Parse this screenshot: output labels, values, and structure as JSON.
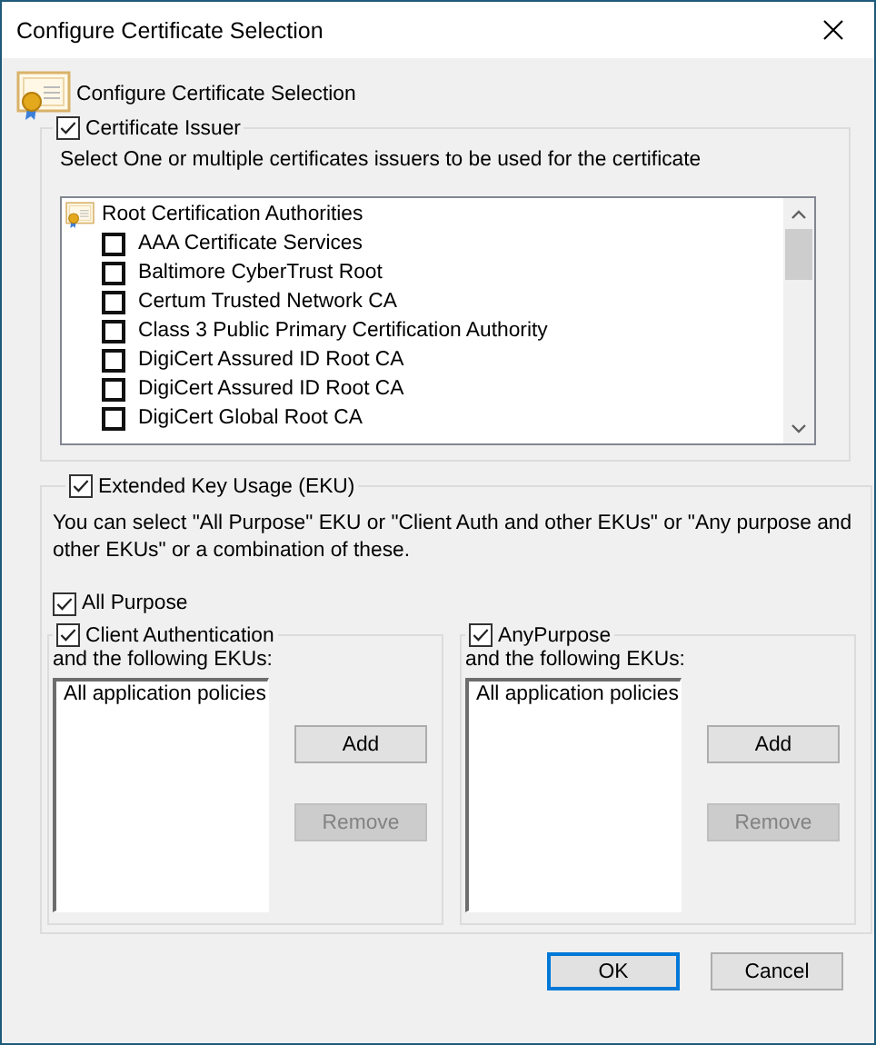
{
  "window": {
    "title": "Configure Certificate Selection"
  },
  "header": {
    "title": "Configure Certificate Selection"
  },
  "issuer_group": {
    "label": "Certificate Issuer",
    "checked": true,
    "description": "Select One or multiple certificates issuers to be used for the certificate",
    "tree": {
      "label": "Root Certification Authorities",
      "children": [
        {
          "label": "AAA Certificate Services",
          "checked": false
        },
        {
          "label": "Baltimore CyberTrust Root",
          "checked": false
        },
        {
          "label": "Certum Trusted Network CA",
          "checked": false
        },
        {
          "label": "Class 3 Public Primary Certification Authority",
          "checked": false
        },
        {
          "label": "DigiCert Assured ID Root CA",
          "checked": false
        },
        {
          "label": "DigiCert Assured ID Root CA",
          "checked": false
        },
        {
          "label": "DigiCert Global Root CA",
          "checked": false
        }
      ]
    }
  },
  "eku_group": {
    "label": "Extended Key Usage (EKU)",
    "checked": true,
    "description": "You can select \"All Purpose\" EKU or \"Client Auth and other EKUs\" or \"Any purpose and other EKUs\" or a combination of these.",
    "all_purpose": {
      "label": "All Purpose",
      "checked": true
    },
    "subgroups": [
      {
        "label": "Client Authentication",
        "checked": true,
        "caption": "and the following EKUs:",
        "items": [
          "All application policies"
        ],
        "buttons": [
          {
            "label": "Add",
            "disabled": false
          },
          {
            "label": "Remove",
            "disabled": true
          }
        ]
      },
      {
        "label": "AnyPurpose",
        "checked": true,
        "caption": "and the following EKUs:",
        "items": [
          "All application policies"
        ],
        "buttons": [
          {
            "label": "Add",
            "disabled": false
          },
          {
            "label": "Remove",
            "disabled": true
          }
        ]
      }
    ]
  },
  "buttons": [
    {
      "label": "OK",
      "default": true
    },
    {
      "label": "Cancel",
      "default": false
    }
  ]
}
